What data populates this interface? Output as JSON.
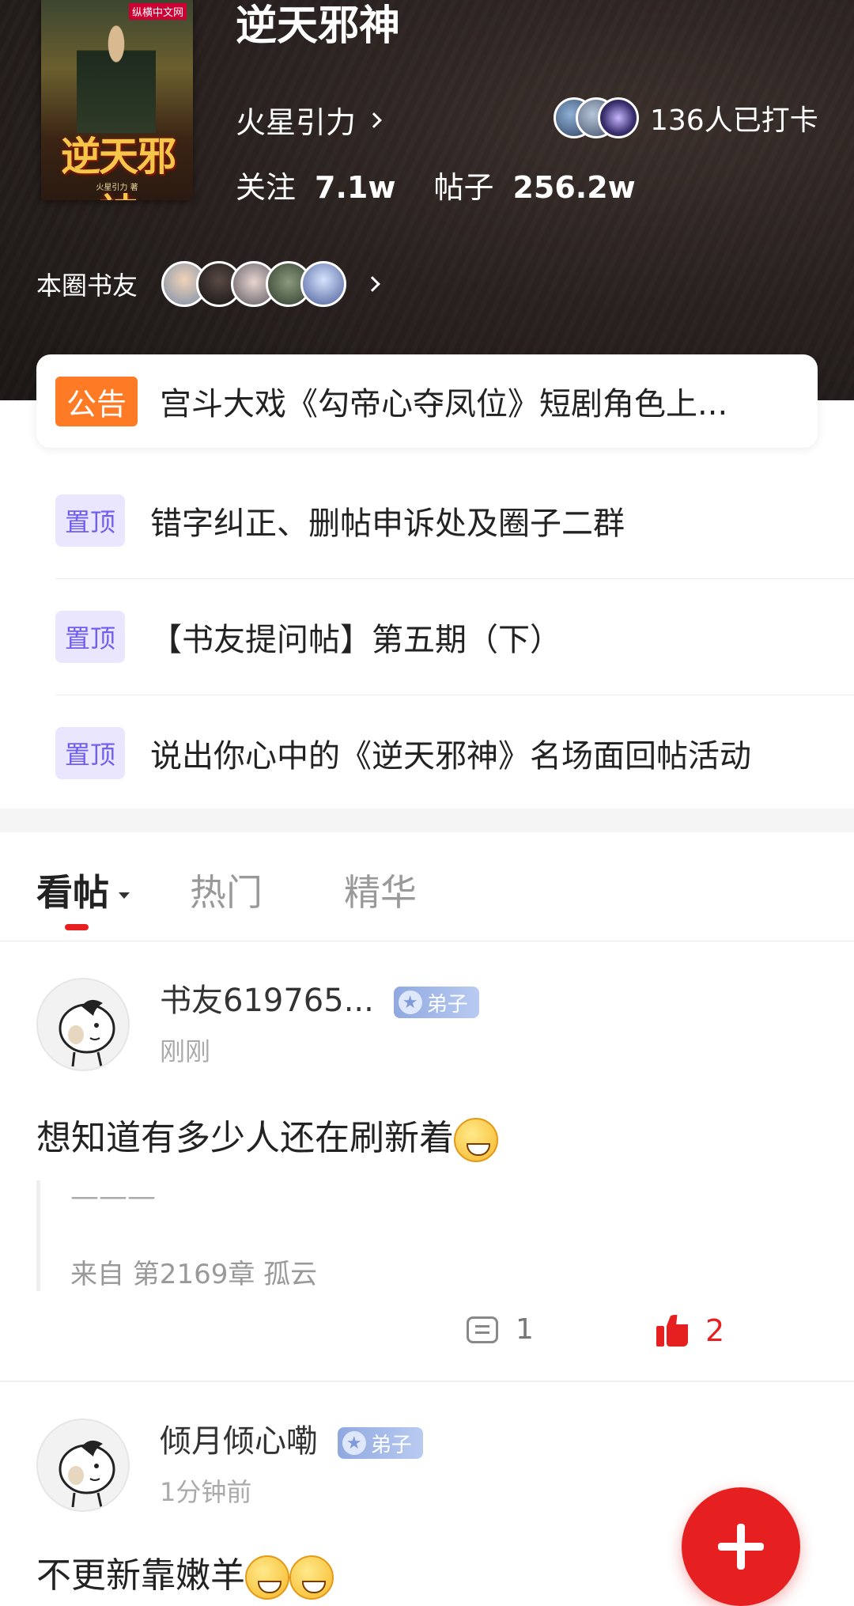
{
  "header": {
    "book_title": "逆天邪神",
    "cover": {
      "publisher": "纵横中文网",
      "title": "逆天邪神",
      "author_line": "火星引力 著"
    },
    "author": "火星引力",
    "checkin_text": "136人已打卡",
    "stats": {
      "follow_label": "关注",
      "follow_value": "7.1w",
      "posts_label": "帖子",
      "posts_value": "256.2w"
    },
    "friends_label": "本圈书友"
  },
  "announcement": {
    "badge": "公告",
    "text": "宫斗大戏《勾帝心夺凤位》短剧角色上..."
  },
  "pinned": [
    {
      "badge": "置顶",
      "title": "错字纠正、删帖申诉处及圈子二群"
    },
    {
      "badge": "置顶",
      "title": "【书友提问帖】第五期（下）"
    },
    {
      "badge": "置顶",
      "title": "说出你心中的《逆天邪神》名场面回帖活动"
    }
  ],
  "tabs": [
    {
      "label": "看帖",
      "active": true
    },
    {
      "label": "热门",
      "active": false
    },
    {
      "label": "精华",
      "active": false
    }
  ],
  "posts": [
    {
      "username": "书友619765...",
      "role": "弟子",
      "time": "刚刚",
      "content": "想知道有多少人还在刷新着",
      "quote_line": "———",
      "quote_source": "来自 第2169章 孤云",
      "comments": "1",
      "likes": "2"
    },
    {
      "username": "倾月倾心嘞",
      "role": "弟子",
      "time": "1分钟前",
      "content": "不更新靠嫩羊"
    }
  ],
  "colors": {
    "accent": "#e62020",
    "announce_badge": "#ff7a24",
    "pinned_badge_bg": "#ebe6ff",
    "pinned_badge_text": "#6f5ff1"
  },
  "icons": {
    "fab": "plus-icon",
    "comment": "comment-icon",
    "like": "thumbs-up-icon"
  }
}
